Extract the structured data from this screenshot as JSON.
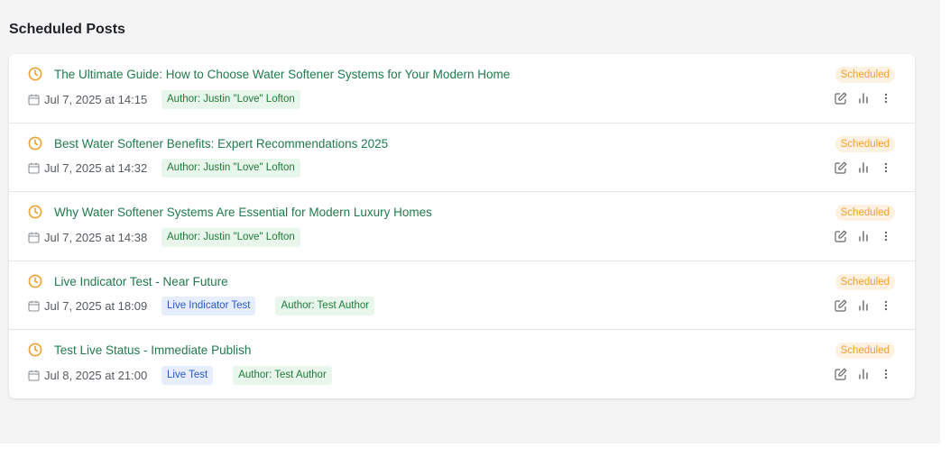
{
  "page": {
    "title": "Scheduled Posts"
  },
  "status_label": "Scheduled",
  "colors": {
    "accent_orange": "#f0a030",
    "title_green": "#1f7a4d",
    "author_tag_bg": "#e9f6ec",
    "label_tag_bg": "#e6eefd"
  },
  "icons": {
    "row_status": "clock-icon",
    "date": "calendar-icon",
    "actions": [
      "edit-icon",
      "analytics-icon",
      "more-options-icon"
    ]
  },
  "posts": [
    {
      "title": "The Ultimate Guide: How to Choose Water Softener Systems for Your Modern Home",
      "date": "Jul 7, 2025 at 14:15",
      "tags": [],
      "author": "Author: Justin \"Love\" Lofton"
    },
    {
      "title": "Best Water Softener Benefits: Expert Recommendations 2025",
      "date": "Jul 7, 2025 at 14:32",
      "tags": [],
      "author": "Author: Justin \"Love\" Lofton"
    },
    {
      "title": "Why Water Softener Systems Are Essential for Modern Luxury Homes",
      "date": "Jul 7, 2025 at 14:38",
      "tags": [],
      "author": "Author: Justin \"Love\" Lofton"
    },
    {
      "title": "Live Indicator Test - Near Future",
      "date": "Jul 7, 2025 at 18:09",
      "tags": [
        "Live Indicator Test"
      ],
      "author": "Author: Test Author"
    },
    {
      "title": "Test Live Status - Immediate Publish",
      "date": "Jul 8, 2025 at 21:00",
      "tags": [
        "Live Test"
      ],
      "author": "Author: Test Author"
    }
  ]
}
